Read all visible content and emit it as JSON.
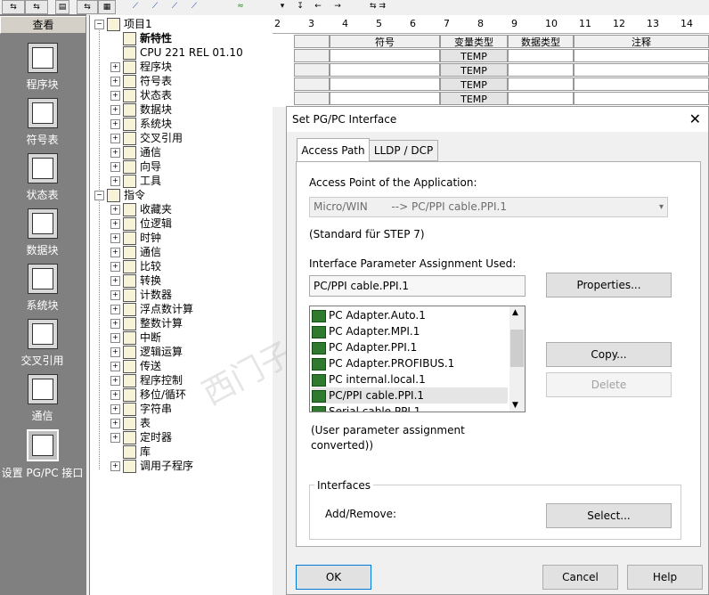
{
  "toolbar": {
    "icons": [
      "network-icon",
      "copy-icon",
      "network-icon",
      "table-icon",
      "run-icon",
      "run-icon",
      "run-icon",
      "run-icon",
      "wave-icon",
      "arrow-icon",
      "arrow-icon",
      "arrow-icon",
      "arrow-icon",
      "arrow-icon"
    ]
  },
  "nav": {
    "header": "查看",
    "items": [
      {
        "label": "程序块",
        "icon": "program-block-icon"
      },
      {
        "label": "符号表",
        "icon": "symbol-table-icon"
      },
      {
        "label": "状态表",
        "icon": "status-table-icon"
      },
      {
        "label": "数据块",
        "icon": "data-block-icon"
      },
      {
        "label": "系统块",
        "icon": "system-block-icon"
      },
      {
        "label": "交叉引用",
        "icon": "cross-ref-icon"
      },
      {
        "label": "通信",
        "icon": "communication-icon"
      },
      {
        "label": "设置 PG/PC 接口",
        "icon": "pgpc-interface-icon"
      }
    ]
  },
  "tree": {
    "items": [
      {
        "label": "项目1",
        "level": 0,
        "exp": "−"
      },
      {
        "label": "新特性",
        "level": 1,
        "exp": "",
        "bold": true
      },
      {
        "label": "CPU 221 REL 01.10",
        "level": 1,
        "exp": ""
      },
      {
        "label": "程序块",
        "level": 1,
        "exp": "+"
      },
      {
        "label": "符号表",
        "level": 1,
        "exp": "+"
      },
      {
        "label": "状态表",
        "level": 1,
        "exp": "+"
      },
      {
        "label": "数据块",
        "level": 1,
        "exp": "+"
      },
      {
        "label": "系统块",
        "level": 1,
        "exp": "+"
      },
      {
        "label": "交叉引用",
        "level": 1,
        "exp": "+"
      },
      {
        "label": "通信",
        "level": 1,
        "exp": "+"
      },
      {
        "label": "向导",
        "level": 1,
        "exp": "+"
      },
      {
        "label": "工具",
        "level": 1,
        "exp": "+"
      },
      {
        "label": "指令",
        "level": 0,
        "exp": "−"
      },
      {
        "label": "收藏夹",
        "level": 1,
        "exp": "+"
      },
      {
        "label": "位逻辑",
        "level": 1,
        "exp": "+"
      },
      {
        "label": "时钟",
        "level": 1,
        "exp": "+"
      },
      {
        "label": "通信",
        "level": 1,
        "exp": "+"
      },
      {
        "label": "比较",
        "level": 1,
        "exp": "+"
      },
      {
        "label": "转换",
        "level": 1,
        "exp": "+"
      },
      {
        "label": "计数器",
        "level": 1,
        "exp": "+"
      },
      {
        "label": "浮点数计算",
        "level": 1,
        "exp": "+"
      },
      {
        "label": "整数计算",
        "level": 1,
        "exp": "+"
      },
      {
        "label": "中断",
        "level": 1,
        "exp": "+"
      },
      {
        "label": "逻辑运算",
        "level": 1,
        "exp": "+"
      },
      {
        "label": "传送",
        "level": 1,
        "exp": "+"
      },
      {
        "label": "程序控制",
        "level": 1,
        "exp": "+"
      },
      {
        "label": "移位/循环",
        "level": 1,
        "exp": "+"
      },
      {
        "label": "字符串",
        "level": 1,
        "exp": "+"
      },
      {
        "label": "表",
        "level": 1,
        "exp": "+"
      },
      {
        "label": "定时器",
        "level": 1,
        "exp": "+"
      },
      {
        "label": "库",
        "level": 1,
        "exp": ""
      },
      {
        "label": "调用子程序",
        "level": 1,
        "exp": "+"
      }
    ]
  },
  "ruler": {
    "ticks": [
      "2",
      "3",
      "4",
      "5",
      "6",
      "7",
      "8",
      "9",
      "10",
      "11",
      "12",
      "13",
      "14"
    ]
  },
  "vartable": {
    "headers": [
      "符号",
      "变量类型",
      "数据类型",
      "注释"
    ],
    "rows": [
      "TEMP",
      "TEMP",
      "TEMP",
      "TEMP"
    ]
  },
  "dialog": {
    "title": "Set PG/PC Interface",
    "close_icon": "close-icon",
    "tabs": [
      "Access Path",
      "LLDP / DCP"
    ],
    "access_point_label": "Access Point of the Application:",
    "access_point_value": "Micro/WIN       --> PC/PPI cable.PPI.1",
    "standard_note": "(Standard für STEP 7)",
    "param_label": "Interface Parameter Assignment Used:",
    "param_value": "PC/PPI cable.PPI.1",
    "properties_btn": "Properties...",
    "list": [
      "PC Adapter.Auto.1",
      "PC Adapter.MPI.1",
      "PC Adapter.PPI.1",
      "PC Adapter.PROFIBUS.1",
      "PC internal.local.1",
      "PC/PPI cable.PPI.1",
      "Serial cable.PPI.1"
    ],
    "selected_index": 5,
    "copy_btn": "Copy...",
    "delete_btn": "Delete",
    "user_note_1": "(User parameter assignment",
    "user_note_2": "converted))",
    "interfaces_group": "Interfaces",
    "add_remove_label": "Add/Remove:",
    "select_btn": "Select...",
    "ok_btn": "OK",
    "cancel_btn": "Cancel",
    "help_btn": "Help"
  },
  "watermark": "西门子工业技术论坛"
}
